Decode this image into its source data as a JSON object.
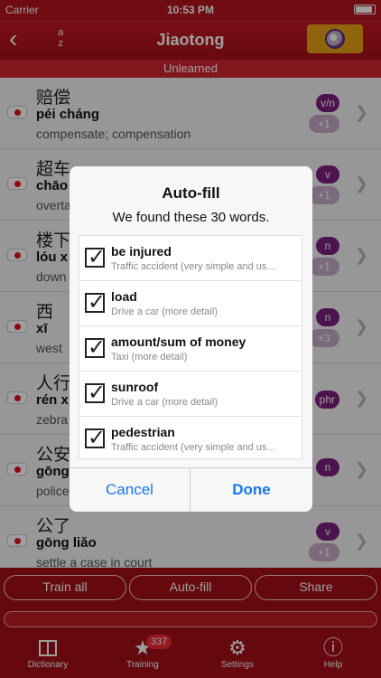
{
  "status": {
    "carrier": "Carrier",
    "time": "10:53 PM"
  },
  "nav": {
    "back_icon": "‹",
    "sort_top": "a",
    "sort_bottom": "z",
    "title": "Jiaotong"
  },
  "section": "Unlearned",
  "rows": [
    {
      "hanzi": "赔偿",
      "pinyin": "péi cháng",
      "meaning": "compensate; compensation",
      "pos": "v/n",
      "count": "+1"
    },
    {
      "hanzi": "超车",
      "pinyin": "chāo",
      "meaning": "overta",
      "pos": "v",
      "count": "+1"
    },
    {
      "hanzi": "楼下",
      "pinyin": "lóu x",
      "meaning": "down",
      "pos": "n",
      "count": "+1"
    },
    {
      "hanzi": "西",
      "pinyin": "xī",
      "meaning": "west",
      "pos": "n",
      "count": "+3"
    },
    {
      "hanzi": "人行",
      "pinyin": "rén x",
      "meaning": "zebra",
      "pos": "phr",
      "count": ""
    },
    {
      "hanzi": "公安",
      "pinyin": "gōng",
      "meaning": "police",
      "pos": "n",
      "count": ""
    },
    {
      "hanzi": "公了",
      "pinyin": "gōng liǎo",
      "meaning": "settle a case in court",
      "pos": "v",
      "count": "+1"
    }
  ],
  "actions": {
    "train_all": "Train all",
    "auto_fill": "Auto-fill",
    "share": "Share"
  },
  "tabs": [
    {
      "label": "Dictionary",
      "icon": "book-icon",
      "glyph": ""
    },
    {
      "label": "Training",
      "icon": "star-icon",
      "glyph": "★",
      "badge": "337"
    },
    {
      "label": "Settings",
      "icon": "gear-icon",
      "glyph": "⚙"
    },
    {
      "label": "Help",
      "icon": "info-icon",
      "glyph": "ⓘ"
    }
  ],
  "dialog": {
    "title": "Auto-fill",
    "message": "We found these 30 words.",
    "items": [
      {
        "word": "be injured",
        "topic": "Traffic accident (very simple and us...",
        "checked": true
      },
      {
        "word": "load",
        "topic": "Drive a car (more detail)",
        "checked": true
      },
      {
        "word": "amount/sum of money",
        "topic": "Taxi (more detail)",
        "checked": true
      },
      {
        "word": "sunroof",
        "topic": "Drive a car (more detail)",
        "checked": true
      },
      {
        "word": "pedestrian",
        "topic": "Traffic accident (very simple and us...",
        "checked": true
      }
    ],
    "cancel": "Cancel",
    "done": "Done"
  },
  "colors": {
    "brand": "#b3141c",
    "accent": "#e9a214",
    "pos_badge": "#7b1f7f",
    "link": "#1a78e8"
  }
}
